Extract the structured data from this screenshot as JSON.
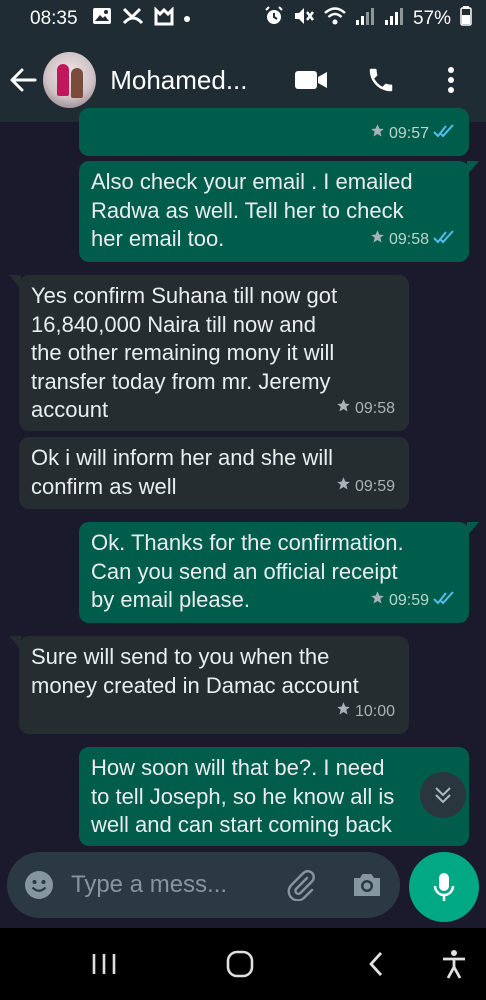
{
  "status_bar": {
    "time": "08:35",
    "battery": "57%",
    "left_icons": [
      "gallery-icon",
      "missed-call-icon",
      "app-icon",
      "dot"
    ],
    "right_icons": [
      "alarm-icon",
      "mute-icon",
      "wifi-icon",
      "signal-icon",
      "signal-icon",
      "battery-icon"
    ]
  },
  "header": {
    "contact_name": "Mohamed...",
    "actions": [
      "video-call-icon",
      "voice-call-icon",
      "more-options-icon"
    ]
  },
  "messages": [
    {
      "direction": "out",
      "text": "",
      "time": "09:57",
      "star": true,
      "read": true
    },
    {
      "direction": "out",
      "text": "Also check your email . I emailed\nRadwa as well. Tell her to check\nher email too.",
      "time": "09:58",
      "star": true,
      "read": true
    },
    {
      "direction": "in",
      "text": "Yes confirm Suhana till now got\n16,840,000 Naira till now and\nthe other remaining mony it will\ntransfer today from mr. Jeremy\naccount",
      "time": "09:58",
      "star": true
    },
    {
      "direction": "in",
      "text": "Ok i will inform her and she will\nconfirm as well",
      "time": "09:59",
      "star": true
    },
    {
      "direction": "out",
      "text": "Ok. Thanks for the confirmation.\nCan you send an official receipt\nby email please.",
      "time": "09:59",
      "star": true,
      "read": true
    },
    {
      "direction": "in",
      "text": "Sure will send to you when the\nmoney created in Damac account",
      "time": "10:00",
      "star": true
    },
    {
      "direction": "out",
      "text": "How soon will that be?. I need\nto tell Joseph, so he know all is\nwell and can start coming back",
      "time": "",
      "star": false,
      "read": false
    }
  ],
  "composer": {
    "placeholder": "Type a mess...",
    "icons": [
      "emoji-icon",
      "attach-icon",
      "camera-icon",
      "mic-icon"
    ]
  },
  "colors": {
    "background": "#1b1a2c",
    "header": "#1f2c34",
    "incoming_bubble": "#262d31",
    "outgoing_bubble": "#005c4b",
    "accent": "#00a884",
    "read_ticks": "#53bdeb"
  }
}
